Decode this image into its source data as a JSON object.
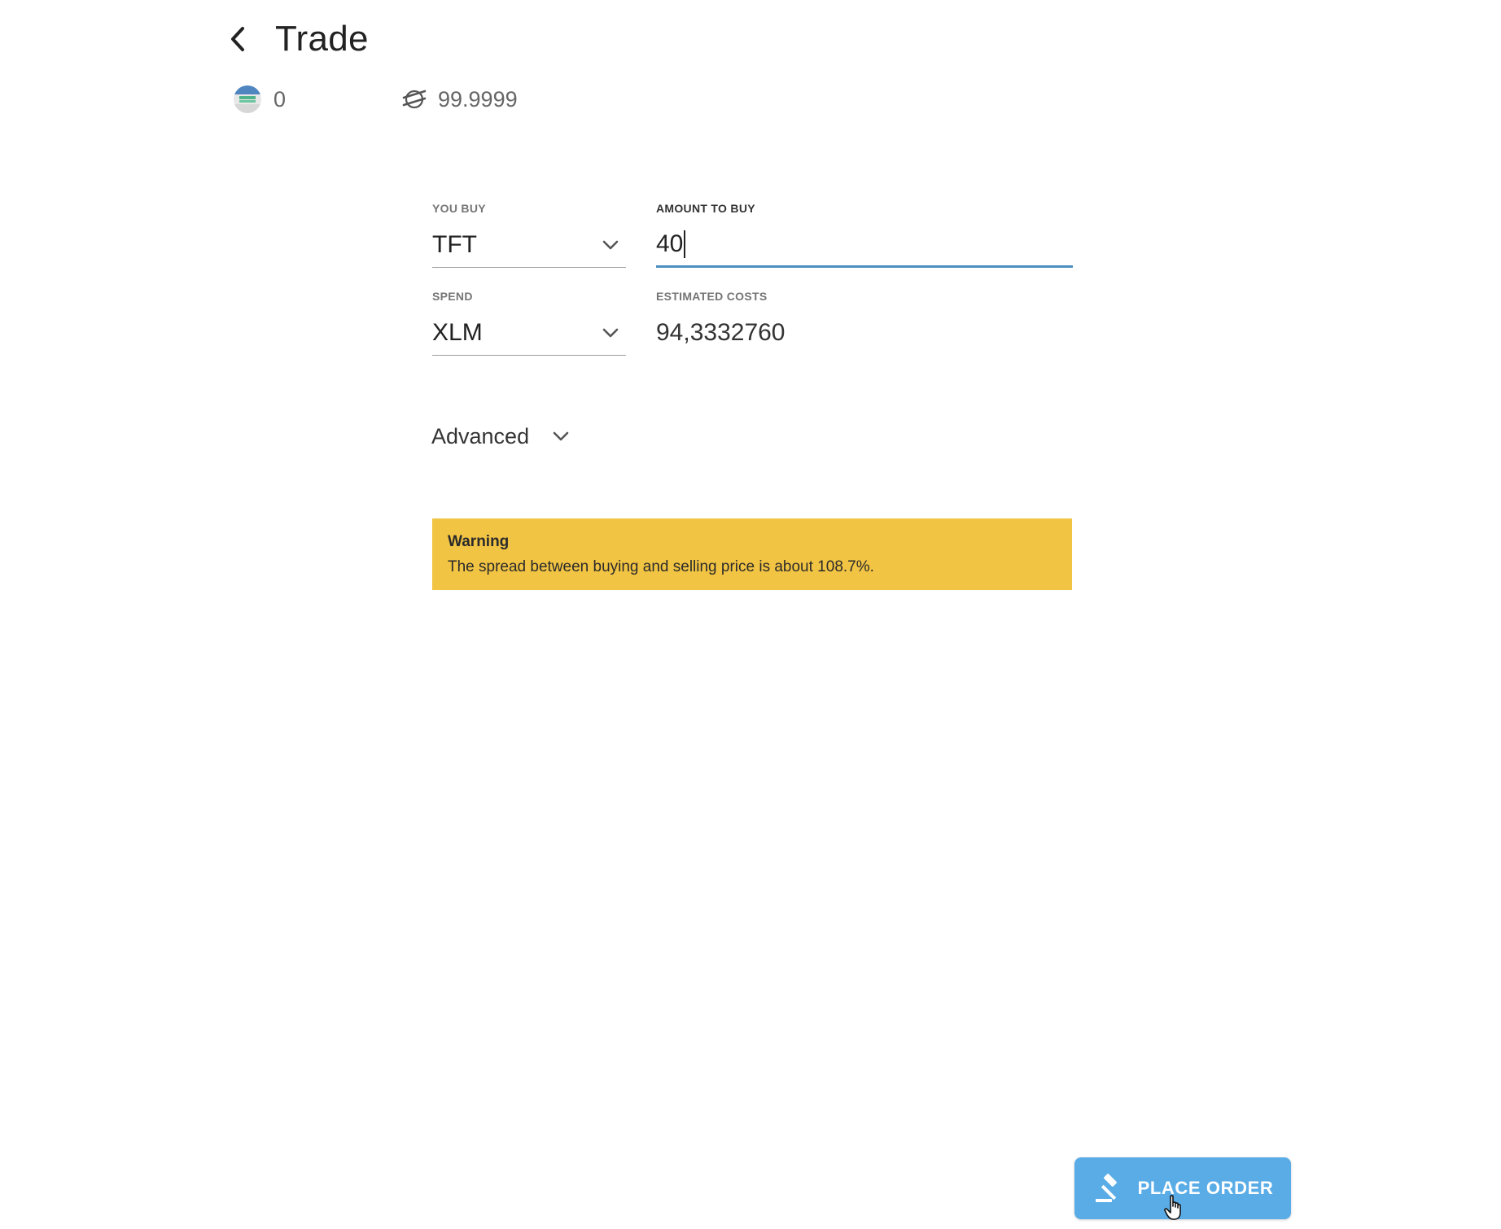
{
  "header": {
    "title": "Trade",
    "back_icon": "chevron-left-icon"
  },
  "balances": [
    {
      "icon": "tft-token-icon",
      "value": "0"
    },
    {
      "icon": "stellar-lumens-icon",
      "value": "99.9999"
    }
  ],
  "form": {
    "you_buy": {
      "label": "YOU BUY",
      "value": "TFT"
    },
    "amount_to_buy": {
      "label": "AMOUNT TO BUY",
      "value": "40"
    },
    "spend": {
      "label": "SPEND",
      "value": "XLM"
    },
    "estimated_costs": {
      "label": "ESTIMATED COSTS",
      "value": "94,3332760"
    }
  },
  "advanced": {
    "label": "Advanced"
  },
  "warning": {
    "title": "Warning",
    "text": "The spread between buying and selling price is about 108.7%."
  },
  "place_order": {
    "label": "PLACE ORDER",
    "icon": "gavel-icon"
  },
  "colors": {
    "accent": "#5aace6",
    "input_underline": "#4a8fbf",
    "warning_bg": "#f2c443"
  }
}
